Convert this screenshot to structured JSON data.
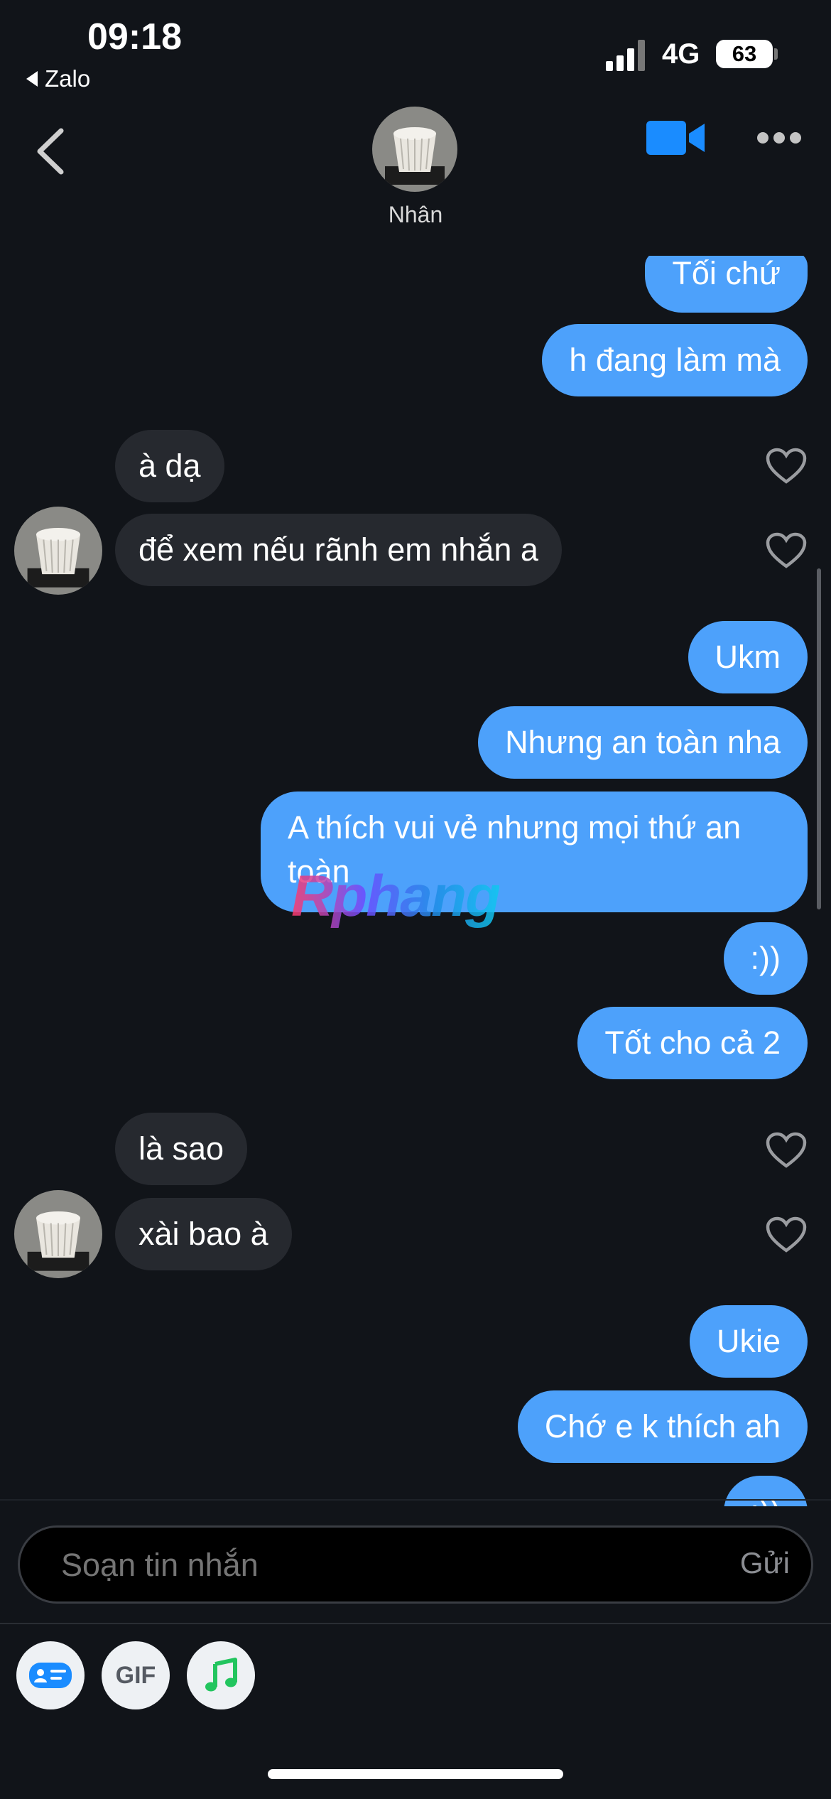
{
  "status_bar": {
    "time": "09:18",
    "back_app": "Zalo",
    "network": "4G",
    "battery": "63"
  },
  "header": {
    "contact_name": "Nhân",
    "icons": [
      "back-chevron-icon",
      "video-call-icon",
      "more-icon"
    ]
  },
  "messages": [
    {
      "from": "me",
      "text": "Tối chứ"
    },
    {
      "from": "me",
      "text": "h đang làm mà"
    },
    {
      "from": "them",
      "text": "à dạ"
    },
    {
      "from": "them",
      "text": "để xem nếu rãnh em nhắn a"
    },
    {
      "from": "me",
      "text": "Ukm"
    },
    {
      "from": "me",
      "text": "Nhưng an toàn nha"
    },
    {
      "from": "me",
      "text": "A thích vui vẻ nhưng mọi thứ an toàn"
    },
    {
      "from": "me",
      "text": ":))"
    },
    {
      "from": "me",
      "text": "Tốt cho cả 2"
    },
    {
      "from": "them",
      "text": "là sao"
    },
    {
      "from": "them",
      "text": "xài bao à"
    },
    {
      "from": "me",
      "text": "Ukie"
    },
    {
      "from": "me",
      "text": "Chớ e k thích ah"
    },
    {
      "from": "me",
      "text": ":))"
    }
  ],
  "watermark": "Rphang",
  "composer": {
    "placeholder": "Soạn tin nhắn",
    "send_label": "Gửi"
  },
  "toolbar": {
    "gif_label": "GIF"
  },
  "colors": {
    "background": "#111419",
    "my_bubble": "#4da1fb",
    "their_bubble": "#26292f",
    "accent": "#1a8cff"
  }
}
